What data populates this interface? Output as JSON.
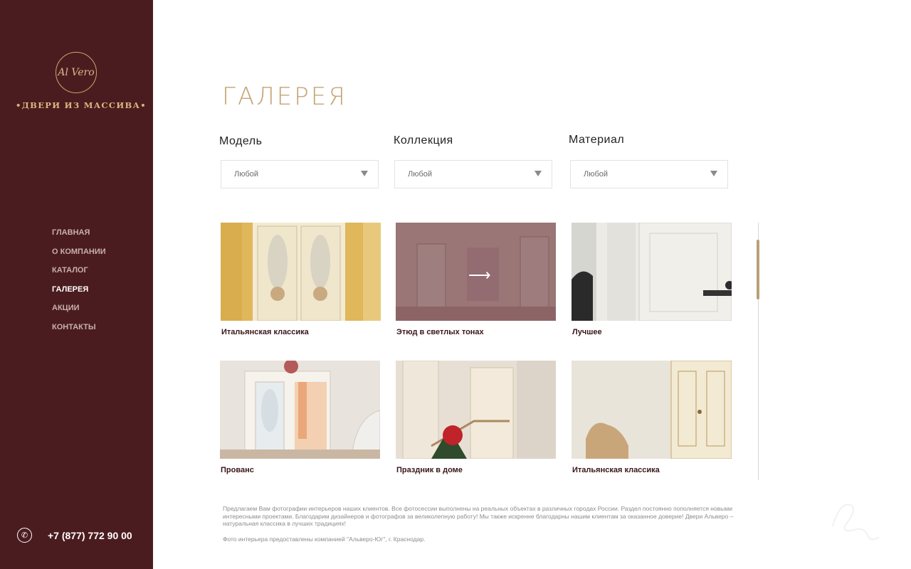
{
  "sidebar": {
    "logo_script": "Al Vero",
    "logo_tagline": "•ДВЕРИ ИЗ МАССИВА•",
    "nav": [
      {
        "label": "ГЛАВНАЯ",
        "active": false
      },
      {
        "label": "О КОМПАНИИ",
        "active": false
      },
      {
        "label": "КАТАЛОГ",
        "active": false
      },
      {
        "label": "ГАЛЕРЕЯ",
        "active": true
      },
      {
        "label": "АКЦИИ",
        "active": false
      },
      {
        "label": "КОНТАКТЫ",
        "active": false
      }
    ],
    "phone": "+7 (877) 772 90 00",
    "phone_icon": "phone-icon"
  },
  "main": {
    "title": "ГАЛЕРЕЯ",
    "filters": [
      {
        "label": "Модель",
        "value": "Любой"
      },
      {
        "label": "Коллекция",
        "value": "Любой"
      },
      {
        "label": "Материал",
        "value": "Любой"
      }
    ],
    "gallery": [
      {
        "caption": "Итальянская классика"
      },
      {
        "caption": "Этюд в светлых тонах"
      },
      {
        "caption": "Лучшее"
      },
      {
        "caption": "Прованс"
      },
      {
        "caption": "Праздник в доме"
      },
      {
        "caption": "Итальянская классика"
      }
    ],
    "description": "Предлагаем Вам фотографии интерьеров наших клиентов. Все фотосессии выполнены на реальных объектах в различных городах России. Раздел постоянно пополняется новыми интересными проектами. Благодарим дизайнеров и фотографов за великолепную работу! Мы также искренне благодарны нашим клиентам за оказанное доверие! Двери Альверо – натуральная классика в лучших традициях!",
    "note": "Фото интерьера предоставлены компанией \"Альверо-Юг\", г. Краснодар."
  },
  "colors": {
    "sidebar_bg": "#4b1c1f",
    "accent_gold": "#c3a575",
    "caption": "#3a1518"
  }
}
